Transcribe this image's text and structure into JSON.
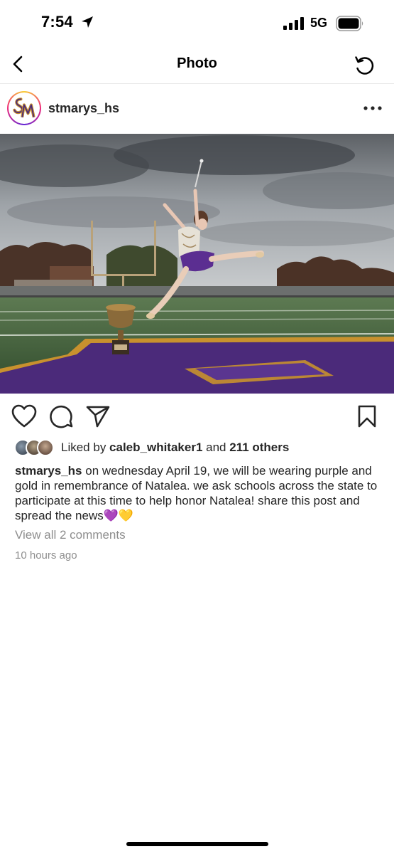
{
  "status_bar": {
    "time": "7:54",
    "network": "5G",
    "icons": [
      "location-arrow-icon",
      "signal-bars-icon",
      "battery-icon"
    ]
  },
  "nav": {
    "title": "Photo",
    "back_icon": "chevron-left-icon",
    "refresh_icon": "refresh-icon"
  },
  "post": {
    "username": "stmarys_hs",
    "avatar_monogram": "SM",
    "more_icon": "ellipsis-icon",
    "actions": [
      "heart-icon",
      "comment-icon",
      "send-icon",
      "bookmark-icon"
    ],
    "likes": {
      "prefix": "Liked by ",
      "liker": "caleb_whitaker1",
      "connector": " and ",
      "others": "211 others"
    },
    "caption": {
      "username": "stmarys_hs",
      "text": " on wednesday April 19, we will be wearing purple and gold in remembrance of Natalea. we ask schools across the state to participate at this time to help honor Natalea! share this post and spread the news💜💛"
    },
    "view_comments": "View all 2 comments",
    "timestamp": "10 hours ago"
  },
  "colors": {
    "primary_text": "#262626",
    "secondary_text": "#8e8e8e",
    "school_purple": "#4b2a7a",
    "school_gold": "#c8912e"
  }
}
